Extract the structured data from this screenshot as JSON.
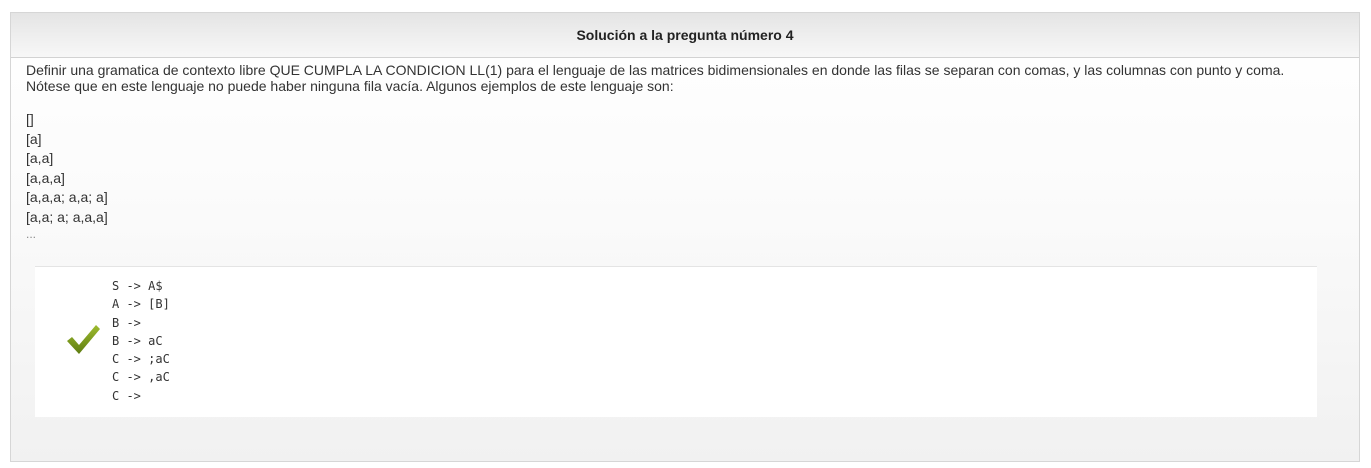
{
  "header": {
    "title": "Solución a la pregunta número 4"
  },
  "question": {
    "text": "Definir una gramatica de contexto libre QUE CUMPLA LA CONDICION LL(1) para el lenguaje de las matrices bidimensionales en donde las filas se separan con comas, y las columnas con punto y coma. Nótese que en este lenguaje no puede haber ninguna fila vacía. Algunos ejemplos de este lenguaje son:",
    "examples": [
      "[]",
      "[a]",
      "[a,a]",
      "[a,a,a]",
      "[a,a,a; a,a; a]",
      "[a,a; a; a,a,a]",
      "..."
    ]
  },
  "answer": {
    "status_icon": "checkmark-icon",
    "status_color": "#7a9a1e",
    "rules": [
      "S -> A$",
      "A -> [B]",
      "B ->",
      "B -> aC",
      "C -> ;aC",
      "C -> ,aC",
      "C ->"
    ]
  }
}
